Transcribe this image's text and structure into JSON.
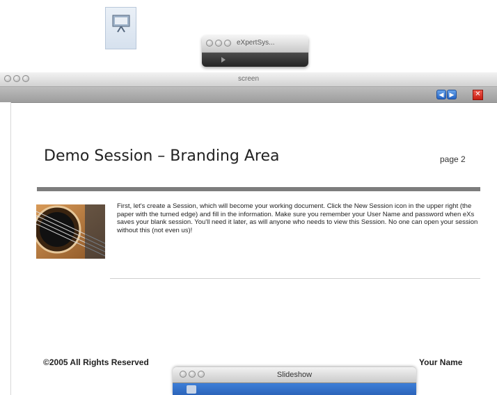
{
  "desktop": {
    "icon": "presentation-icon"
  },
  "mini_window": {
    "title": "eXpertSys..."
  },
  "screen_window": {
    "title": "screen",
    "toolbar": {
      "prev_icon": "arrow-left-icon",
      "next_icon": "arrow-right-icon",
      "close_icon": "close-icon"
    }
  },
  "page": {
    "title": "Demo Session – Branding Area",
    "page_label": "page 2",
    "body": "First, let's create a Session, which will become your working document. Click the New Session icon in the upper right (the paper with the turned edge) and fill in the information. Make sure you remember your User Name and password when eXs saves your blank session. You'll need it later, as will anyone who needs to view this Session. No one can open your session without this (not even us)!",
    "footer_left": "©2005 All Rights Reserved",
    "footer_right": "Your Name"
  },
  "slideshow_window": {
    "title": "Slideshow"
  },
  "colors": {
    "rule": "#7d7d7d",
    "nav_blue": "#2564c4",
    "close_red": "#c61d12"
  }
}
